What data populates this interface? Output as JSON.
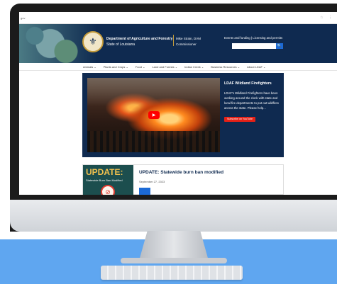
{
  "browser": {
    "url_fragment": "gov",
    "tools": "☆ ⋮"
  },
  "header": {
    "seal_glyph": "⚜",
    "department": "Department of Agriculture and Forestry",
    "state": "State of Louisiana",
    "commissioner_name": "Mike Strain, DVM",
    "commissioner_title": "Commissioner",
    "top_links": "Events and funding | Licensing and permits",
    "search_placeholder": "",
    "search_icon": "search-icon",
    "search_glyph": "🔍"
  },
  "nav": {
    "items": [
      {
        "label": "Animals ⌄"
      },
      {
        "label": "Plants and Crops ⌄"
      },
      {
        "label": "Food ⌄"
      },
      {
        "label": "Land and Forests ⌄"
      },
      {
        "label": "Indian Creek ⌄"
      },
      {
        "label": "Business Resources ⌄"
      },
      {
        "label": "About LDAF ⌄"
      }
    ]
  },
  "hero": {
    "play_glyph": "▶",
    "title": "LDAF Wildland Firefighters",
    "body": "LDAF's Wildland Firefighters have been working around the clock with state and local fire departments to put out wildfires across the state. Please help...",
    "subscribe_label": "Subscribe on YouTube"
  },
  "news": {
    "thumb_heading": "UPDATE:",
    "thumb_subheading": "Statewide Burn Ban Modified",
    "no_burn_glyph": "⊘",
    "title": "UPDATE: Statewide burn ban modified",
    "date": "September 27, 2023"
  },
  "colors": {
    "header_bg": "#0f2a50",
    "accent_gold": "#c49b3a",
    "button_blue": "#1c6ad6",
    "youtube_red": "#ff0000",
    "desk_blue": "#5fa6f0"
  }
}
